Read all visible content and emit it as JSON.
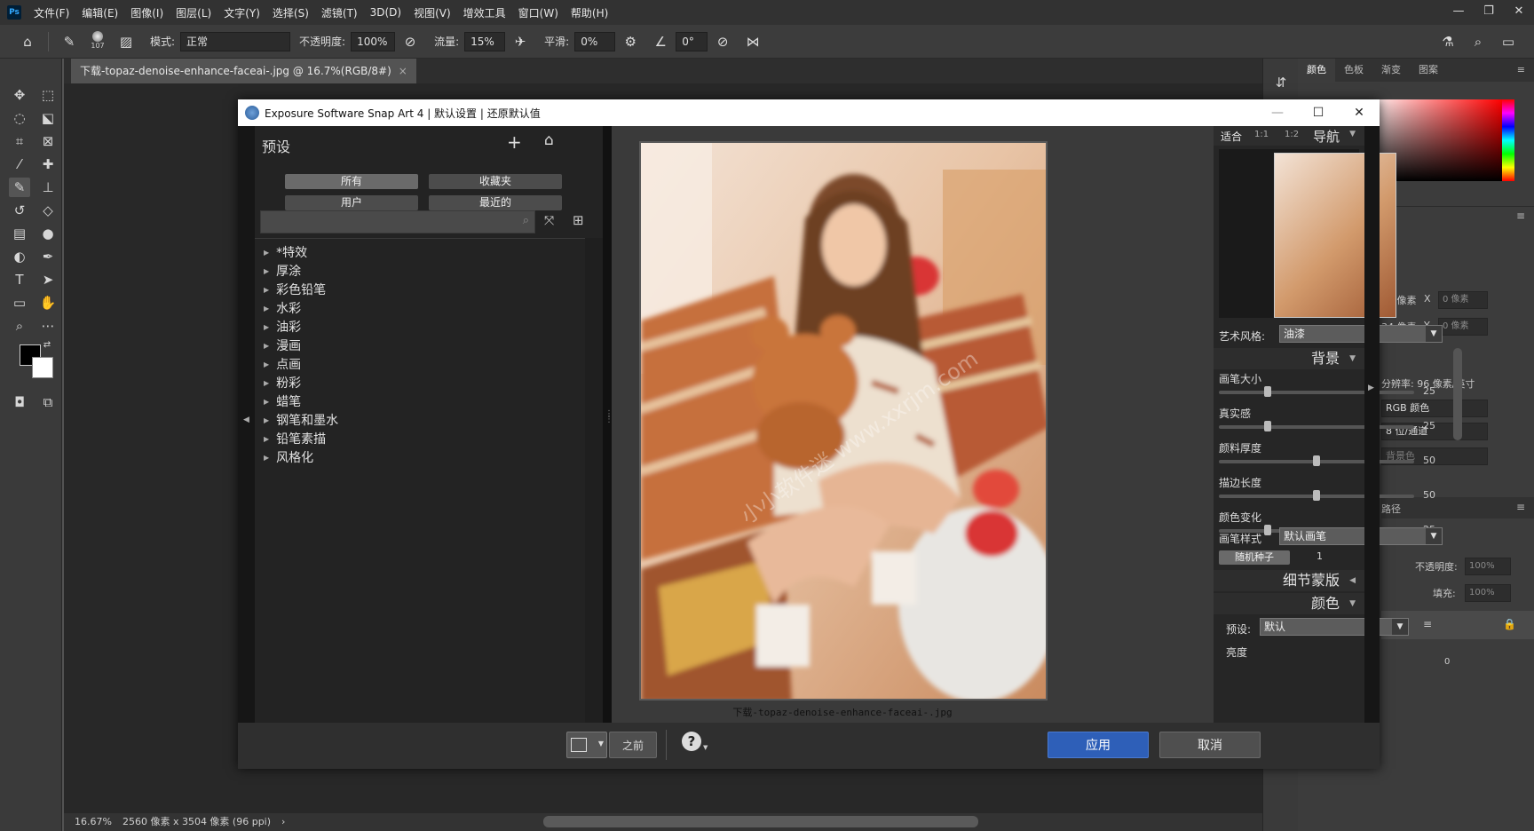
{
  "app": {
    "logo": "Ps"
  },
  "menu": [
    "文件(F)",
    "编辑(E)",
    "图像(I)",
    "图层(L)",
    "文字(Y)",
    "选择(S)",
    "滤镜(T)",
    "3D(D)",
    "视图(V)",
    "增效工具",
    "窗口(W)",
    "帮助(H)"
  ],
  "window_controls": {
    "minimize": "—",
    "restore": "❐",
    "close": "✕"
  },
  "options": {
    "brush_size": "107",
    "mode_label": "模式:",
    "mode_value": "正常",
    "opacity_label": "不透明度:",
    "opacity_value": "100%",
    "flow_label": "流量:",
    "flow_value": "15%",
    "smooth_label": "平滑:",
    "smooth_value": "0%",
    "angle_value": "0°"
  },
  "document": {
    "tab_title": "下载-topaz-denoise-enhance-faceai-.jpg @ 16.7%(RGB/8#)",
    "tab_close": "×",
    "zoom": "16.67%",
    "size_info": "2560 像素 x 3504 像素 (96 ppi)"
  },
  "right_panel": {
    "color_tabs": [
      "颜色",
      "色板",
      "渐变",
      "图案"
    ],
    "width_value": "50 像素",
    "x_label": "X",
    "x_placeholder": "0 像素",
    "height_value": "34 像素",
    "y_label": "Y",
    "y_placeholder": "0 像素",
    "resolution": "分辨率: 96 像素/英寸",
    "mode": "RGB 颜色",
    "depth": "8 位/通道",
    "bg": "背景色",
    "paths_tab": "路径",
    "opacity_label": "不透明度:",
    "opacity_value": "100%",
    "fill_label": "填充:",
    "fill_value": "100%"
  },
  "dialog": {
    "title": "Exposure Software Snap Art 4 | 默认设置 | 还原默认值",
    "minimize": "—",
    "maximize": "☐",
    "close": "✕",
    "presets": {
      "title": "预设",
      "filters": [
        "所有",
        "收藏夹",
        "用户",
        "最近的"
      ],
      "search_placeholder": "",
      "categories": [
        "*特效",
        "厚涂",
        "彩色铅笔",
        "水彩",
        "油彩",
        "漫画",
        "点画",
        "粉彩",
        "蜡笔",
        "钢笔和墨水",
        "铅笔素描",
        "风格化"
      ]
    },
    "preview": {
      "filename": "下载-topaz-denoise-enhance-faceai-.jpg",
      "watermark": "小小软件迷 www.xxrjm.com"
    },
    "nav": {
      "fit": "适合",
      "one_one": "1:1",
      "one_two": "1:2",
      "title": "导航"
    },
    "style": {
      "label": "艺术风格:",
      "value": "油漆"
    },
    "background": {
      "title": "背景",
      "sliders": [
        {
          "label": "画笔大小",
          "value": 25
        },
        {
          "label": "真实感",
          "value": 25
        },
        {
          "label": "颜料厚度",
          "value": 50
        },
        {
          "label": "描边长度",
          "value": 50
        },
        {
          "label": "颜色变化",
          "value": 25
        }
      ],
      "brush_style_label": "画笔样式",
      "brush_style_value": "默认画笔",
      "random_seed_label": "随机种子",
      "random_seed_value": "1"
    },
    "detail_mask": {
      "title": "细节蒙版"
    },
    "color": {
      "title": "颜色",
      "preset_label": "预设:",
      "preset_value": "默认",
      "brightness_label": "亮度",
      "brightness_value": "0"
    },
    "footer": {
      "before": "之前",
      "help": "?",
      "apply": "应用",
      "cancel": "取消"
    }
  },
  "colors": {
    "apply_button": "#2e5fb8",
    "dialog_bg": "#1d1d1d",
    "ps_bg": "#535353"
  }
}
